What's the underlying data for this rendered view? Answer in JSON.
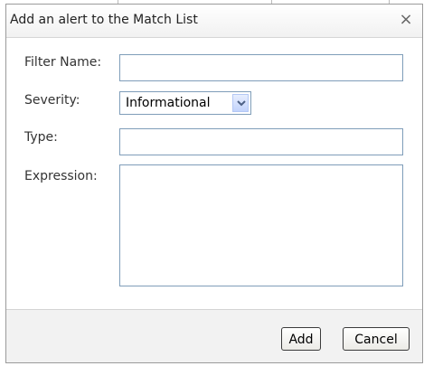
{
  "dialog": {
    "title": "Add an alert to the Match List",
    "close_glyph": "×",
    "close_icon": "close-icon"
  },
  "form": {
    "filter_name": {
      "label": "Filter Name:",
      "value": ""
    },
    "severity": {
      "label": "Severity:",
      "value": "Informational",
      "icon": "chevron-down-icon"
    },
    "type": {
      "label": "Type:",
      "value": ""
    },
    "expression": {
      "label": "Expression:",
      "value": ""
    }
  },
  "footer": {
    "add_label": "Add",
    "cancel_label": "Cancel"
  },
  "colors": {
    "input_border": "#7f9db9",
    "dropdown_arrow": "#4d6185"
  }
}
